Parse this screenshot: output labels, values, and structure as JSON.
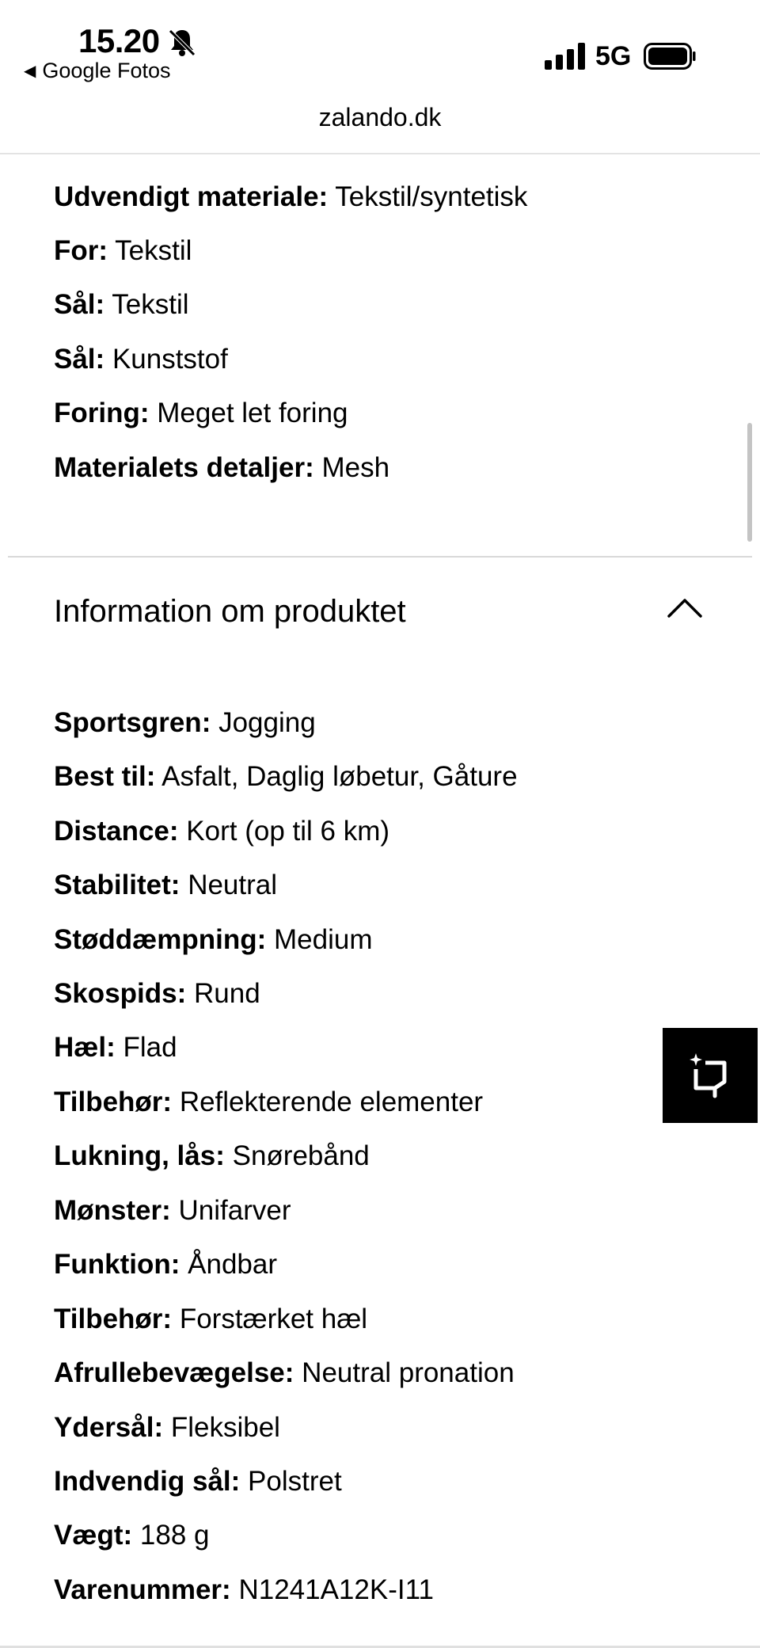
{
  "status_bar": {
    "time": "15.20",
    "back_app": "Google Fotos",
    "network": "5G"
  },
  "browser": {
    "url": "zalando.dk"
  },
  "materials": [
    {
      "key": "Udvendigt materiale:",
      "value": "Tekstil/syntetisk"
    },
    {
      "key": "For:",
      "value": "Tekstil"
    },
    {
      "key": "Sål:",
      "value": "Tekstil"
    },
    {
      "key": "Sål:",
      "value": "Kunststof"
    },
    {
      "key": "Foring:",
      "value": "Meget let foring"
    },
    {
      "key": "Materialets detaljer:",
      "value": "Mesh"
    }
  ],
  "product_info": {
    "title": "Information om produktet",
    "items": [
      {
        "key": "Sportsgren:",
        "value": "Jogging"
      },
      {
        "key": "Best til:",
        "value": "Asfalt, Daglig løbetur, Gåture"
      },
      {
        "key": "Distance:",
        "value": "Kort (op til 6 km)"
      },
      {
        "key": "Stabilitet:",
        "value": "Neutral"
      },
      {
        "key": "Støddæmpning:",
        "value": "Medium"
      },
      {
        "key": "Skospids:",
        "value": "Rund"
      },
      {
        "key": "Hæl:",
        "value": "Flad"
      },
      {
        "key": "Tilbehør:",
        "value": "Reflekterende elementer"
      },
      {
        "key": "Lukning, lås:",
        "value": "Snørebånd"
      },
      {
        "key": "Mønster:",
        "value": "Unifarver"
      },
      {
        "key": "Funktion:",
        "value": "Åndbar"
      },
      {
        "key": "Tilbehør:",
        "value": "Forstærket hæl"
      },
      {
        "key": "Afrullebevægelse:",
        "value": "Neutral pronation"
      },
      {
        "key": "Ydersål:",
        "value": "Fleksibel"
      },
      {
        "key": "Indvendig sål:",
        "value": "Polstret"
      },
      {
        "key": "Vægt:",
        "value": "188 g"
      },
      {
        "key": "Varenummer:",
        "value": "N1241A12K-I11"
      }
    ]
  },
  "icons": {
    "bell": "bell-muted-icon",
    "signal": "cellular-signal-icon",
    "battery": "battery-icon",
    "chevron": "chevron-up-icon",
    "floating": "crop-sparkle-icon"
  }
}
